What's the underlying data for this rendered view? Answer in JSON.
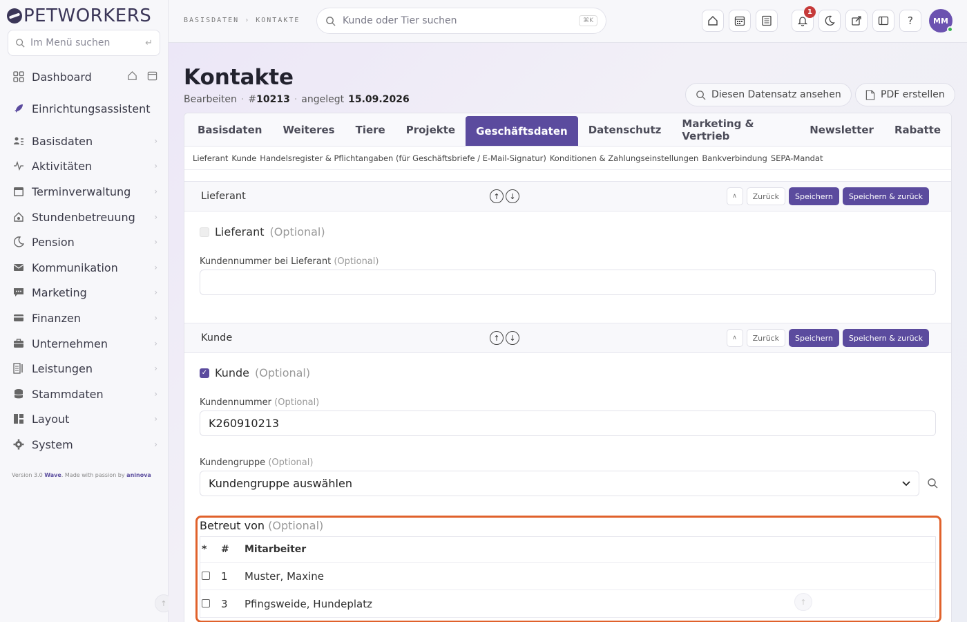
{
  "brand": {
    "name": "PETWORKERS"
  },
  "sidebar": {
    "search_placeholder": "Im Menü suchen",
    "items": [
      {
        "label": "Dashboard",
        "icon": "grid-icon"
      },
      {
        "label": "Einrichtungsassistent",
        "icon": "rocket-icon"
      },
      {
        "label": "Basisdaten",
        "icon": "list-user-icon"
      },
      {
        "label": "Aktivitäten",
        "icon": "activity-icon"
      },
      {
        "label": "Terminverwaltung",
        "icon": "calendar-icon"
      },
      {
        "label": "Stundenbetreuung",
        "icon": "home-paw-icon"
      },
      {
        "label": "Pension",
        "icon": "moon-icon"
      },
      {
        "label": "Kommunikation",
        "icon": "mail-icon"
      },
      {
        "label": "Marketing",
        "icon": "chat-icon"
      },
      {
        "label": "Finanzen",
        "icon": "card-icon"
      },
      {
        "label": "Unternehmen",
        "icon": "briefcase-icon"
      },
      {
        "label": "Leistungen",
        "icon": "list-icon"
      },
      {
        "label": "Stammdaten",
        "icon": "database-icon"
      },
      {
        "label": "Layout",
        "icon": "layout-icon"
      },
      {
        "label": "System",
        "icon": "gear-icon"
      }
    ],
    "version_text": "Version 3.0",
    "version_name": "Wave",
    "version_mid": ". Made with passion by",
    "version_author": "aninova"
  },
  "topbar": {
    "breadcrumb": [
      "BASISDATEN",
      "KONTAKTE"
    ],
    "search_placeholder": "Kunde oder Tier suchen",
    "search_shortcut": "⌘K",
    "notification_count": "1",
    "avatar_initials": "MM"
  },
  "page": {
    "title": "Kontakte",
    "mode": "Bearbeiten",
    "record_prefix": "#",
    "record_id": "10213",
    "created_label": "angelegt",
    "created_date": "15.09.2026",
    "btn_view": "Diesen Datensatz ansehen",
    "btn_pdf": "PDF erstellen"
  },
  "tabs": [
    "Basisdaten",
    "Weiteres",
    "Tiere",
    "Projekte",
    "Geschäftsdaten",
    "Datenschutz",
    "Marketing & Vertrieb",
    "Newsletter",
    "Rabatte"
  ],
  "active_tab": "Geschäftsdaten",
  "subnav": [
    "Lieferant",
    "Kunde",
    "Handelsregister & Pflichtangaben (für Geschäftsbriefe / E-Mail-Signatur)",
    "Konditionen & Zahlungseinstellungen",
    "Bankverbindung",
    "SEPA-Mandat"
  ],
  "section_actions": {
    "back": "Zurück",
    "save": "Speichern",
    "save_back": "Speichern & zurück"
  },
  "lieferant": {
    "title": "Lieferant",
    "checkbox_label": "Lieferant",
    "optional": "(Optional)",
    "kundennummer_label": "Kundennummer bei Lieferant",
    "kundennummer_value": ""
  },
  "kunde": {
    "title": "Kunde",
    "checkbox_label": "Kunde",
    "optional": "(Optional)",
    "kundennummer_label": "Kundennummer",
    "kundennummer_value": "K260910213",
    "kundengruppe_label": "Kundengruppe",
    "kundengruppe_value": "Kundengruppe auswählen",
    "betreut_label": "Betreut von",
    "table": {
      "headers": [
        "*",
        "#",
        "Mitarbeiter"
      ],
      "rows": [
        {
          "num": "1",
          "name": "Muster, Maxine"
        },
        {
          "num": "3",
          "name": "Pfingsweide, Hundeplatz"
        }
      ]
    }
  },
  "colors": {
    "accent": "#5b4b9e",
    "highlight": "#e0612b"
  }
}
